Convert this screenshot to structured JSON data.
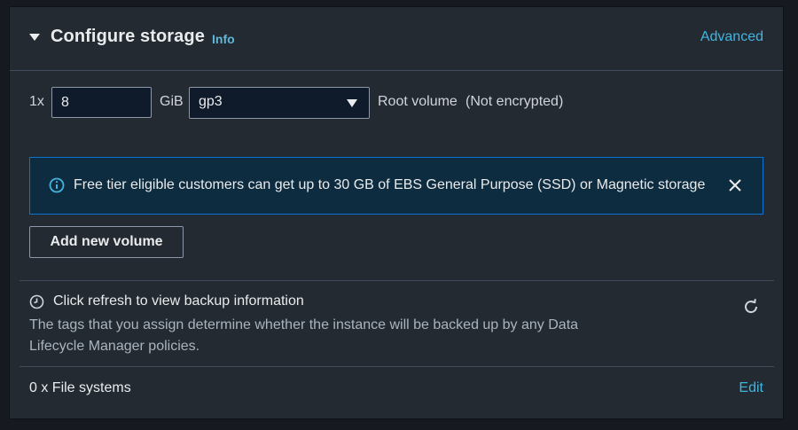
{
  "section": {
    "title": "Configure storage",
    "info_link": "Info",
    "advanced_link": "Advanced"
  },
  "volume": {
    "count_label": "1x",
    "size_value": "8",
    "unit_label": "GiB",
    "type_selected": "gp3",
    "root_label": "Root volume",
    "encryption_label": "(Not encrypted)"
  },
  "alert": {
    "icon": "info-circle-icon",
    "message": "Free tier eligible customers can get up to 30 GB of EBS General Purpose (SSD) or Magnetic storage",
    "close_icon": "close-icon"
  },
  "add_volume_button": "Add new volume",
  "backup": {
    "icon": "clock-icon",
    "title": "Click refresh to view backup information",
    "description": "The tags that you assign determine whether the instance will be backed up by any Data Lifecycle Manager policies.",
    "refresh_icon": "refresh-icon"
  },
  "file_systems": {
    "label": "0 x File systems",
    "edit_link": "Edit"
  },
  "colors": {
    "panel_bg": "#232a31",
    "link": "#42b4e0",
    "alert_border": "#0972d3",
    "alert_bg": "#0e2c3f"
  }
}
